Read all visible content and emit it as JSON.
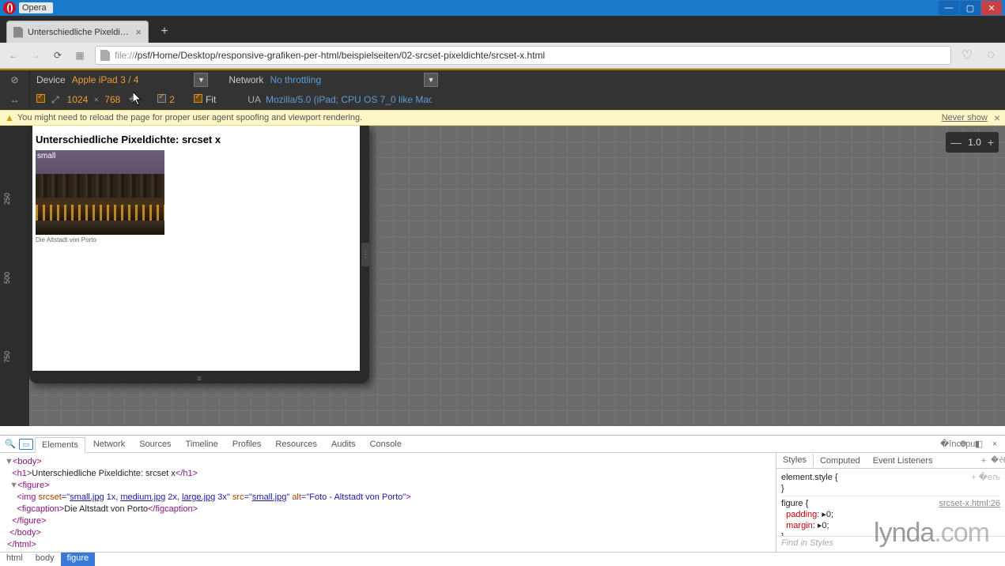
{
  "app": {
    "name": "Opera"
  },
  "tab": {
    "title": "Unterschiedliche Pixeldich..."
  },
  "url": {
    "scheme": "file://",
    "path": "/psf/Home/Desktop/responsive-grafiken-per-html/beispielseiten/02-srcset-pixeldichte/srcset-x.html"
  },
  "device_toolbar": {
    "device_label": "Device",
    "device_value": "Apple iPad 3 / 4",
    "network_label": "Network",
    "network_value": "No throttling",
    "width": "1024",
    "height": "768",
    "dpr": "2",
    "fit_label": "Fit",
    "ua_label": "UA",
    "ua_value": "Mozilla/5.0 (iPad; CPU OS 7_0 like Mac ...",
    "dim_sep": "×"
  },
  "warning": {
    "text": "You might need to reload the page for proper user agent spoofing and viewport rendering.",
    "never": "Never show"
  },
  "zoom": {
    "value": "1.0"
  },
  "ruler": {
    "t250": "250",
    "t500": "500",
    "t750": "750"
  },
  "page": {
    "h1": "Unterschiedliche Pixeldichte: srcset x",
    "img_label": "small",
    "caption": "Die Altstadt von Porto"
  },
  "devtools": {
    "tabs": {
      "elements": "Elements",
      "network": "Network",
      "sources": "Sources",
      "timeline": "Timeline",
      "profiles": "Profiles",
      "resources": "Resources",
      "audits": "Audits",
      "console": "Console"
    },
    "side_tabs": {
      "styles": "Styles",
      "computed": "Computed",
      "event": "Event Listeners"
    },
    "crumb": {
      "html": "html",
      "body": "body",
      "figure": "figure"
    },
    "find": "Find in Styles",
    "markup": {
      "body_open": "<body>",
      "h1_open": "<h1>",
      "h1_text": "Unterschiedliche Pixeldichte: srcset x",
      "h1_close": "</h1>",
      "fig_open": "<figure>",
      "img_open": "<img ",
      "srcset_attr": "srcset",
      "eq": "=\"",
      "s1": "small.jpg",
      "x1": " 1x, ",
      "s2": "medium.jpg",
      "x2": " 2x, ",
      "s3": "large.jpg",
      "x3": " 3x\"",
      "sp": " ",
      "src_attr": "src",
      "q": "=\"",
      "src_v": "small.jpg",
      "qend": "\"",
      "alt_attr": "alt",
      "alt_v": "Foto - Altstadt von Porto",
      "close_tag": ">",
      "figc_open": "<figcaption>",
      "figc_text": "Die Altstadt von Porto",
      "figc_close": "</figcaption>",
      "fig_close": "</figure>",
      "body_close": "</body>",
      "html_close": "</html>"
    },
    "styles": {
      "elstyle": "element.style {",
      "brace": "}",
      "figsel": "figure {",
      "src": "srcset-x.html:26",
      "padding": "padding",
      "padv": ": ▸0;",
      "margin": "margin",
      "margv": ": ▸0;"
    }
  },
  "watermark": {
    "a": "lynda",
    "b": ".com"
  }
}
